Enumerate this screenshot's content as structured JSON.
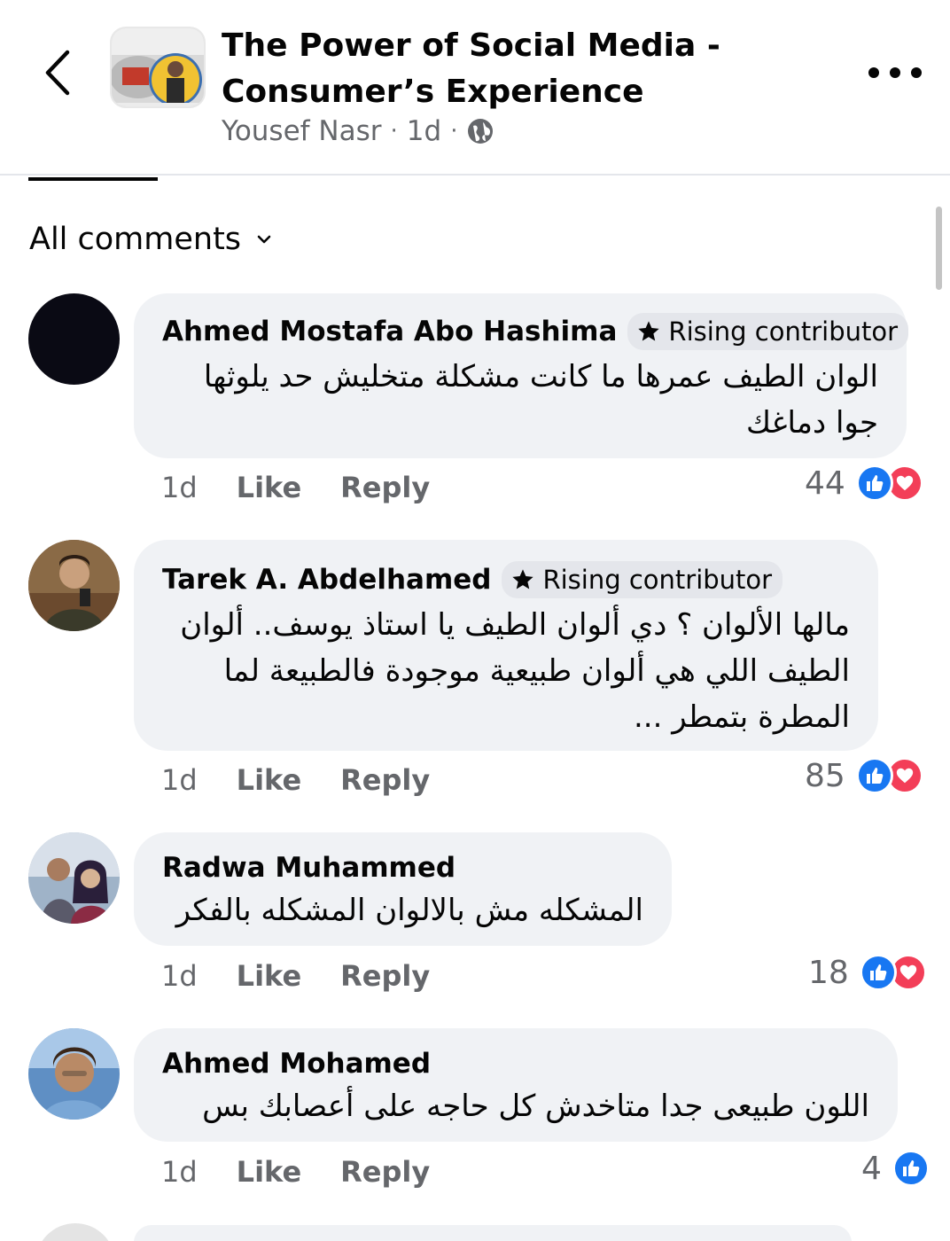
{
  "header": {
    "title_line1": "The Power of Social Media -",
    "title_line2": "Consumer’s Experience",
    "author": "Yousef Nasr",
    "separator": "·",
    "age": "1d"
  },
  "sort": {
    "label": "All comments"
  },
  "actions_labels": {
    "like": "Like",
    "reply": "Reply"
  },
  "comments": [
    {
      "author": "Ahmed Mostafa Abo Hashima",
      "badge": "Rising contributor",
      "text": "الوان الطيف عمرها ما كانت مشكلة متخليش حد يلوثها جوا دماغك",
      "time": "1d",
      "reaction_count": "44",
      "reactions": [
        "like-icon",
        "love-icon"
      ]
    },
    {
      "author": "Tarek A. Abdelhamed",
      "badge": "Rising contributor",
      "text": "مالها الألوان ؟ دي ألوان الطيف يا استاذ يوسف.. ألوان الطيف اللي هي ألوان طبيعية موجودة فالطبيعة لما المطرة بتمطر ...",
      "time": "1d",
      "reaction_count": "85",
      "reactions": [
        "like-icon",
        "love-icon"
      ]
    },
    {
      "author": "Radwa Muhammed",
      "badge": "",
      "text": "المشكله مش بالالوان المشكله بالفكر",
      "time": "1d",
      "reaction_count": "18",
      "reactions": [
        "like-icon",
        "love-icon"
      ]
    },
    {
      "author": "Ahmed Mohamed",
      "badge": "",
      "text": "اللون طبيعى جدا متاخدش كل حاجه على أعصابك بس",
      "time": "1d",
      "reaction_count": "4",
      "reactions": [
        "like-icon"
      ]
    }
  ],
  "colors": {
    "text_primary": "#050505",
    "text_secondary": "#65676b",
    "bubble": "#f0f2f5",
    "like_blue": "#1877f2",
    "love_red": "#f33e58"
  }
}
